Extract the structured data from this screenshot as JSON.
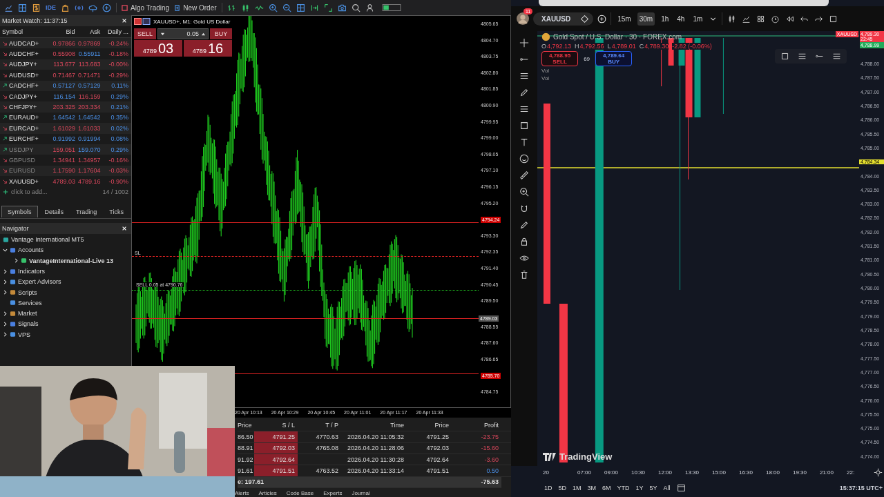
{
  "mt5": {
    "toolbar": {
      "ide": "IDE",
      "algo_trading": "Algo Trading",
      "new_order": "New Order"
    },
    "market_watch": {
      "title": "Market Watch: 11:37:15",
      "columns": [
        "Symbol",
        "Bid",
        "Ask",
        "Daily ..."
      ],
      "rows": [
        {
          "symbol": "AUDCAD+",
          "bid": "0.97866",
          "ask": "0.97869",
          "daily": "-0.24%",
          "rising": false,
          "bid_up": false,
          "ask_up": false,
          "daily_up": false,
          "dimmed": false
        },
        {
          "symbol": "AUDCHF+",
          "bid": "0.55908",
          "ask": "0.55911",
          "daily": "-0.18%",
          "rising": false,
          "bid_up": false,
          "ask_up": true,
          "daily_up": false,
          "dimmed": false
        },
        {
          "symbol": "AUDJPY+",
          "bid": "113.677",
          "ask": "113.683",
          "daily": "-0.00%",
          "rising": false,
          "bid_up": false,
          "ask_up": false,
          "daily_up": false,
          "dimmed": false
        },
        {
          "symbol": "AUDUSD+",
          "bid": "0.71467",
          "ask": "0.71471",
          "daily": "-0.29%",
          "rising": false,
          "bid_up": false,
          "ask_up": false,
          "daily_up": false,
          "dimmed": false
        },
        {
          "symbol": "CADCHF+",
          "bid": "0.57127",
          "ask": "0.57129",
          "daily": "0.11%",
          "rising": true,
          "bid_up": true,
          "ask_up": true,
          "daily_up": true,
          "dimmed": false
        },
        {
          "symbol": "CADJPY+",
          "bid": "116.154",
          "ask": "116.159",
          "daily": "0.29%",
          "rising": false,
          "bid_up": true,
          "ask_up": false,
          "daily_up": true,
          "dimmed": false
        },
        {
          "symbol": "CHFJPY+",
          "bid": "203.325",
          "ask": "203.334",
          "daily": "0.21%",
          "rising": false,
          "bid_up": false,
          "ask_up": false,
          "daily_up": true,
          "dimmed": false
        },
        {
          "symbol": "EURAUD+",
          "bid": "1.64542",
          "ask": "1.64542",
          "daily": "0.35%",
          "rising": true,
          "bid_up": true,
          "ask_up": true,
          "daily_up": true,
          "dimmed": false
        },
        {
          "symbol": "EURCAD+",
          "bid": "1.61029",
          "ask": "1.61033",
          "daily": "0.02%",
          "rising": false,
          "bid_up": false,
          "ask_up": false,
          "daily_up": true,
          "dimmed": false
        },
        {
          "symbol": "EURCHF+",
          "bid": "0.91992",
          "ask": "0.91994",
          "daily": "0.08%",
          "rising": true,
          "bid_up": true,
          "ask_up": true,
          "daily_up": true,
          "dimmed": false
        },
        {
          "symbol": "USDJPY",
          "bid": "159.051",
          "ask": "159.070",
          "daily": "0.29%",
          "rising": true,
          "bid_up": false,
          "ask_up": true,
          "daily_up": true,
          "dimmed": true
        },
        {
          "symbol": "GBPUSD",
          "bid": "1.34941",
          "ask": "1.34957",
          "daily": "-0.16%",
          "rising": false,
          "bid_up": false,
          "ask_up": false,
          "daily_up": false,
          "dimmed": true
        },
        {
          "symbol": "EURUSD",
          "bid": "1.17590",
          "ask": "1.17604",
          "daily": "-0.03%",
          "rising": false,
          "bid_up": false,
          "ask_up": false,
          "daily_up": false,
          "dimmed": true
        },
        {
          "symbol": "XAUUSD+",
          "bid": "4789.03",
          "ask": "4789.16",
          "daily": "-0.90%",
          "rising": false,
          "bid_up": false,
          "ask_up": false,
          "daily_up": false,
          "dimmed": false
        }
      ],
      "add_hint": "click to add...",
      "count": "14 / 1002",
      "tabs": [
        {
          "label": "Symbols",
          "selected": true
        },
        {
          "label": "Details",
          "selected": false
        },
        {
          "label": "Trading",
          "selected": false
        },
        {
          "label": "Ticks",
          "selected": false
        }
      ]
    },
    "navigator": {
      "title": "Navigator",
      "tree": [
        {
          "label": "Vantage International MT5",
          "children": [
            {
              "label": "Accounts",
              "expanded": true,
              "children": [
                {
                  "label": "VantageInternational-Live 13",
                  "expanded": false,
                  "active": true
                }
              ]
            },
            {
              "label": "Indicators",
              "expanded": false
            },
            {
              "label": "Expert Advisors",
              "expanded": false
            },
            {
              "label": "Scripts",
              "expanded": false
            },
            {
              "label": "Services"
            },
            {
              "label": "Market",
              "expanded": false
            },
            {
              "label": "Signals",
              "expanded": false
            },
            {
              "label": "VPS",
              "expanded": false
            }
          ]
        }
      ]
    },
    "chart": {
      "title": "XAUUSD+, M1:  Gold US Dollar",
      "sell": "SELL",
      "buy": "BUY",
      "volume": "0.05",
      "sell_big": "4789",
      "sell_small": "03",
      "buy_big": "4789",
      "buy_small": "16",
      "sl_label": "SL",
      "order_label": "SELL 0.05 at 4790.76",
      "price_ticks": [
        {
          "label": "4805.65",
          "kind": "tick"
        },
        {
          "label": "4804.70",
          "kind": "tick"
        },
        {
          "label": "4803.75",
          "kind": "tick"
        },
        {
          "label": "4802.80",
          "kind": "tick"
        },
        {
          "label": "4801.85",
          "kind": "tick"
        },
        {
          "label": "4800.90",
          "kind": "tick"
        },
        {
          "label": "4799.95",
          "kind": "tick"
        },
        {
          "label": "4799.00",
          "kind": "tick"
        },
        {
          "label": "4798.05",
          "kind": "tick"
        },
        {
          "label": "4797.10",
          "kind": "tick"
        },
        {
          "label": "4796.15",
          "kind": "tick"
        },
        {
          "label": "4795.20",
          "kind": "tick"
        },
        {
          "label": "4794.24",
          "kind": "alert"
        },
        {
          "label": "4793.30",
          "kind": "tick"
        },
        {
          "label": "4792.35",
          "kind": "tick"
        },
        {
          "label": "4791.40",
          "kind": "tick"
        },
        {
          "label": "4790.45",
          "kind": "tick"
        },
        {
          "label": "4789.50",
          "kind": "tick"
        },
        {
          "label": "4789.03",
          "kind": "bid"
        },
        {
          "label": "4788.55",
          "kind": "tick"
        },
        {
          "label": "4787.60",
          "kind": "tick"
        },
        {
          "label": "4786.65",
          "kind": "tick"
        },
        {
          "label": "4785.70",
          "kind": "alert"
        },
        {
          "label": "4784.75",
          "kind": "tick"
        }
      ],
      "time_ticks": [
        "20 Apr 10:13",
        "20 Apr 10:29",
        "20 Apr 10:45",
        "20 Apr 11:01",
        "20 Apr 11:17",
        "20 Apr 11:33"
      ]
    },
    "trades": {
      "columns": [
        "Price",
        "S / L",
        "T / P",
        "Time",
        "Price",
        "Profit"
      ],
      "rows": [
        {
          "open": "86.50",
          "sl": "4791.25",
          "tp": "4770.63",
          "time": "2026.04.20 11:05:32",
          "current": "4791.25",
          "profit": "-23.75",
          "positive": false
        },
        {
          "open": "88.91",
          "sl": "4792.03",
          "tp": "4765.08",
          "time": "2026.04.20 11:28:06",
          "current": "4792.03",
          "profit": "-15.60",
          "positive": false
        },
        {
          "open": "91.92",
          "sl": "4792.64",
          "time": "2026.04.20 11:30:28",
          "current": "4792.64",
          "profit": "-3.60",
          "positive": false
        },
        {
          "open": "91.61",
          "sl": "4791.51",
          "tp": "4763.52",
          "time": "2026.04.20 11:33:14",
          "current": "4791.51",
          "profit": "0.50",
          "positive": true
        }
      ],
      "total_label": "e: 197.61",
      "total_profit": "-75.63"
    },
    "bottom_tabs": [
      "Alerts",
      "Articles",
      "Code Base",
      "Experts",
      "Journal"
    ]
  },
  "tradingview": {
    "avatar_badge": "11",
    "symbol": "XAUUSD",
    "intervals": [
      {
        "label": "15m",
        "selected": false
      },
      {
        "label": "30m",
        "selected": true
      },
      {
        "label": "1h",
        "selected": false
      },
      {
        "label": "4h",
        "selected": false
      },
      {
        "label": "1m",
        "selected": false
      }
    ],
    "legend": {
      "title": "Gold Spot / U.S. Dollar · 30 · FOREX.com",
      "ohlc": [
        {
          "key": "O",
          "value": "4,792.13"
        },
        {
          "key": "H",
          "value": "4,792.56"
        },
        {
          "key": "L",
          "value": "4,789.01"
        },
        {
          "key": "C",
          "value": "4,789.30"
        }
      ],
      "change": "-2.82 (-0.06%)"
    },
    "sell": {
      "price": "4,788.95",
      "label": "SELL"
    },
    "spread": "69",
    "buy": {
      "price": "4,789.64",
      "label": "BUY"
    },
    "vol_labels": [
      "Vol",
      "Vol"
    ],
    "logo": "TradingView",
    "axis_top": {
      "symbol_tag": "XAUUSD",
      "last": "4,789.30",
      "countdown": "22:45",
      "bid": "4,788.99"
    },
    "price_ticks": [
      {
        "label": "4,788.00",
        "kind": "tick"
      },
      {
        "label": "4,787.50",
        "kind": "tick"
      },
      {
        "label": "4,787.00",
        "kind": "tick"
      },
      {
        "label": "4,786.50",
        "kind": "tick"
      },
      {
        "label": "4,786.00",
        "kind": "tick"
      },
      {
        "label": "4,785.50",
        "kind": "tick"
      },
      {
        "label": "4,785.00",
        "kind": "tick"
      },
      {
        "label": "4,784.34",
        "kind": "marker"
      },
      {
        "label": "4,784.00",
        "kind": "tick"
      },
      {
        "label": "4,783.50",
        "kind": "tick"
      },
      {
        "label": "4,783.00",
        "kind": "tick"
      },
      {
        "label": "4,782.50",
        "kind": "tick"
      },
      {
        "label": "4,782.00",
        "kind": "tick"
      },
      {
        "label": "4,781.50",
        "kind": "tick"
      },
      {
        "label": "4,781.00",
        "kind": "tick"
      },
      {
        "label": "4,780.50",
        "kind": "tick"
      },
      {
        "label": "4,780.00",
        "kind": "tick"
      },
      {
        "label": "4,779.50",
        "kind": "tick"
      },
      {
        "label": "4,779.00",
        "kind": "tick"
      },
      {
        "label": "4,778.50",
        "kind": "tick"
      },
      {
        "label": "4,778.00",
        "kind": "tick"
      },
      {
        "label": "4,777.50",
        "kind": "tick"
      },
      {
        "label": "4,777.00",
        "kind": "tick"
      },
      {
        "label": "4,776.50",
        "kind": "tick"
      },
      {
        "label": "4,776.00",
        "kind": "tick"
      },
      {
        "label": "4,775.50",
        "kind": "tick"
      },
      {
        "label": "4,775.00",
        "kind": "tick"
      },
      {
        "label": "4,774.50",
        "kind": "tick"
      },
      {
        "label": "4,774.00",
        "kind": "tick"
      }
    ],
    "time_ticks": [
      "20",
      "07:00",
      "09:00",
      "10:30",
      "12:00",
      "13:30",
      "15:00",
      "16:30",
      "18:00",
      "19:30",
      "21:00",
      "22:"
    ],
    "ranges": [
      "1D",
      "5D",
      "1M",
      "3M",
      "6M",
      "YTD",
      "1Y",
      "5Y",
      "All"
    ],
    "clock": "15:37:15 UTC+"
  }
}
